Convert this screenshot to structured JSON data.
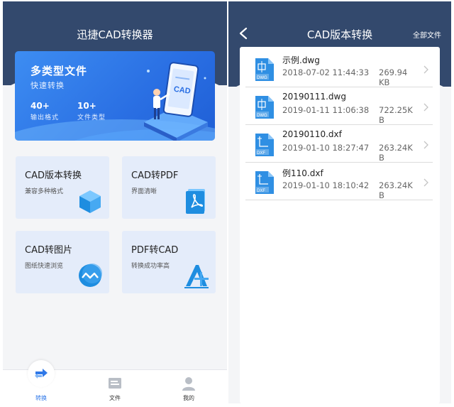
{
  "colors": {
    "header_bg": "#33496d",
    "accent": "#2f78e8",
    "card_bg": "#e4ecfa",
    "page_bg": "#f4f5f7"
  },
  "left": {
    "app_title": "迅捷CAD转换器",
    "banner": {
      "title": "多类型文件",
      "subtitle": "快速转换",
      "stats": [
        {
          "num": "40+",
          "label": "输出格式"
        },
        {
          "num": "10+",
          "label": "文件类型"
        }
      ]
    },
    "cards": [
      {
        "title": "CAD版本转换",
        "desc": "兼容多种格式",
        "icon": "cube-icon"
      },
      {
        "title": "CAD转PDF",
        "desc": "界面清晰",
        "icon": "pdf-icon"
      },
      {
        "title": "CAD转图片",
        "desc": "图纸快速浏览",
        "icon": "image-wave-icon"
      },
      {
        "title": "PDF转CAD",
        "desc": "转换成功率高",
        "icon": "cad-ruler-icon"
      }
    ],
    "tabs": [
      {
        "label": "转换",
        "icon": "convert-icon",
        "active": true
      },
      {
        "label": "文件",
        "icon": "file-icon",
        "active": false
      },
      {
        "label": "我的",
        "icon": "user-icon",
        "active": false
      }
    ]
  },
  "right": {
    "title": "CAD版本转换",
    "all_files": "全部文件",
    "files": [
      {
        "name": "示例.dwg",
        "date": "2018-07-02 11:44:33",
        "size": "269.94 KB",
        "type": "DWG"
      },
      {
        "name": "20190111.dwg",
        "date": "2019-01-11 11:06:38",
        "size": "722.25K B",
        "type": "DWG"
      },
      {
        "name": "20190110.dxf",
        "date": "2019-01-10 18:27:47",
        "size": "263.24K B",
        "type": "DXF"
      },
      {
        "name": "例110.dxf",
        "date": "2019-01-10 18:10:42",
        "size": "263.24K B",
        "type": "DXF"
      }
    ]
  }
}
